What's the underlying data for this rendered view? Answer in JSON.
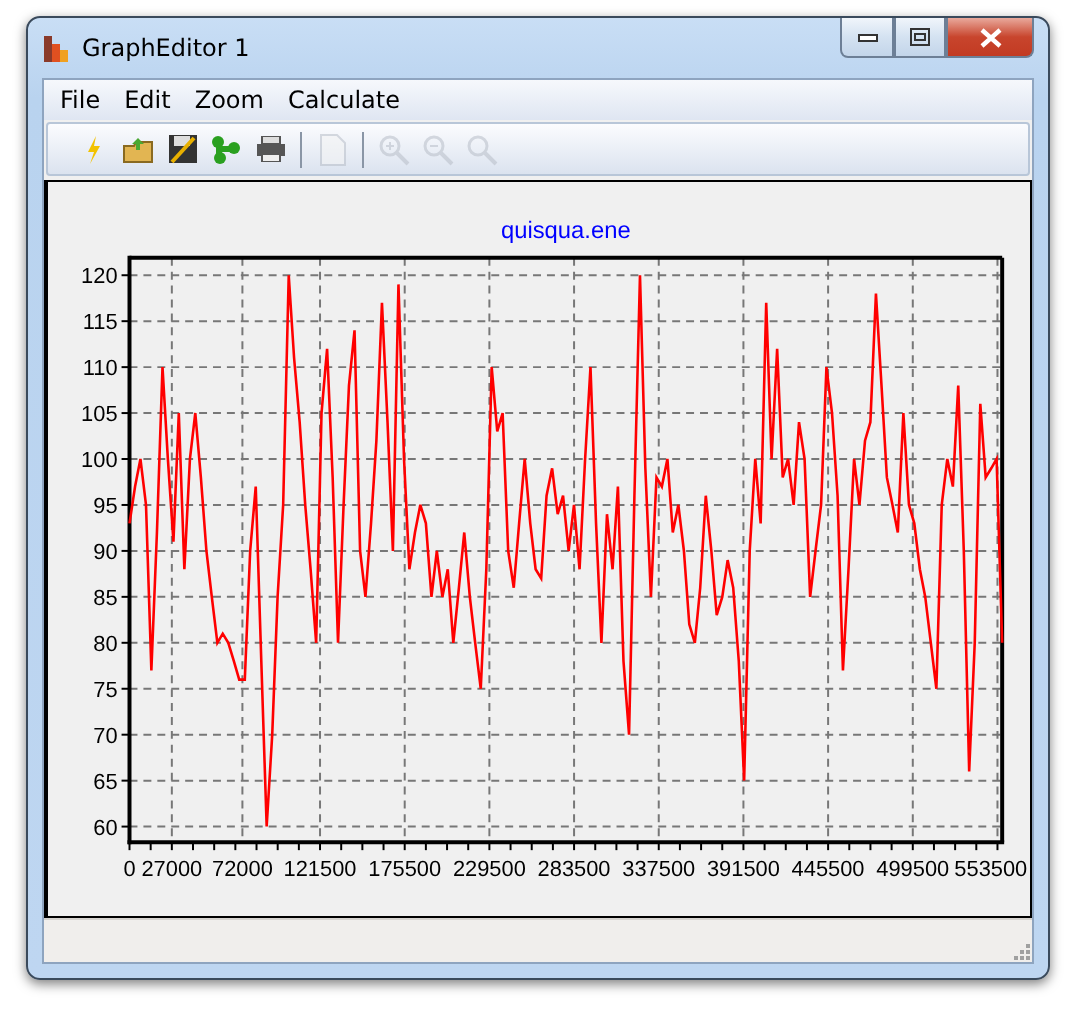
{
  "window": {
    "title": "GraphEditor 1"
  },
  "menu": [
    {
      "label": "File"
    },
    {
      "label": "Edit"
    },
    {
      "label": "Zoom"
    },
    {
      "label": "Calculate"
    }
  ],
  "toolbar": [
    {
      "kind": "lightning",
      "disabled": false
    },
    {
      "kind": "open",
      "disabled": false
    },
    {
      "kind": "save",
      "disabled": false
    },
    {
      "kind": "tree",
      "disabled": false
    },
    {
      "kind": "print",
      "disabled": false
    },
    {
      "kind": "separator"
    },
    {
      "kind": "page",
      "disabled": true
    },
    {
      "kind": "separator"
    },
    {
      "kind": "zoom-in",
      "disabled": true
    },
    {
      "kind": "zoom-out",
      "disabled": true
    },
    {
      "kind": "zoom",
      "disabled": true
    }
  ],
  "graph": {
    "chart_data": {
      "type": "line",
      "title": "quisqua.ene",
      "xlim": [
        0,
        556500
      ],
      "ylim": [
        58.3,
        121.9
      ],
      "grid": true,
      "xticks": [
        0,
        27000,
        72000,
        121500,
        175500,
        229500,
        283500,
        337500,
        391500,
        445500,
        499500,
        553500
      ],
      "yticks": [
        60,
        65,
        70,
        75,
        80,
        85,
        90,
        95,
        100,
        105,
        110,
        115,
        120
      ],
      "x": [
        0,
        3500,
        7000,
        10500,
        14000,
        17500,
        21000,
        24500,
        28000,
        31500,
        35000,
        38500,
        42000,
        45500,
        49000,
        52500,
        56000,
        59500,
        63000,
        66500,
        70000,
        73500,
        77000,
        80500,
        84000,
        87500,
        91000,
        94500,
        98000,
        101500,
        105000,
        108500,
        112000,
        115500,
        119000,
        122500,
        126000,
        129500,
        133000,
        136500,
        140000,
        143500,
        147000,
        150500,
        154000,
        157500,
        161000,
        164500,
        168000,
        171500,
        175000,
        178500,
        182000,
        185500,
        189000,
        192500,
        196000,
        199500,
        203000,
        206500,
        210000,
        213500,
        217000,
        220500,
        224000,
        227500,
        231000,
        234500,
        238000,
        241500,
        245000,
        248500,
        252000,
        255500,
        259000,
        262500,
        266000,
        269500,
        273000,
        276500,
        280000,
        283500,
        287000,
        290500,
        294000,
        297500,
        301000,
        304500,
        308000,
        311500,
        315000,
        318500,
        322000,
        325500,
        329000,
        332500,
        336000,
        339500,
        343000,
        346500,
        350000,
        353500,
        357000,
        360500,
        364000,
        367500,
        371000,
        374500,
        378000,
        381500,
        385000,
        388500,
        392000,
        395500,
        399000,
        402500,
        406000,
        409500,
        413000,
        416500,
        420000,
        423500,
        427000,
        430500,
        434000,
        437500,
        441000,
        444500,
        448000,
        451500,
        455000,
        458500,
        462000,
        465500,
        469000,
        472500,
        476000,
        479500,
        483000,
        486500,
        490000,
        493500,
        497000,
        500500,
        504000,
        507500,
        511000,
        514500,
        518000,
        521500,
        525000,
        528500,
        532000,
        535500,
        539000,
        542500,
        546000,
        549500,
        553000,
        556500
      ],
      "series": [
        {
          "color": "#ff0000",
          "values": [
            93,
            97,
            100,
            95,
            77,
            92,
            110,
            100,
            91,
            105,
            88,
            100,
            105,
            98,
            90,
            85,
            80,
            81,
            80,
            78,
            76,
            76,
            90,
            97,
            78,
            60,
            70,
            85,
            95,
            120,
            111,
            104,
            95,
            88,
            80,
            105,
            112,
            98,
            80,
            95,
            108,
            114,
            90,
            85,
            93,
            102,
            117,
            104,
            90,
            119,
            100,
            88,
            92,
            95,
            93,
            85,
            90,
            85,
            88,
            80,
            86,
            92,
            85,
            80,
            75,
            88,
            110,
            103,
            105,
            90,
            86,
            93,
            100,
            93,
            88,
            87,
            96,
            99,
            94,
            96,
            90,
            95,
            88,
            100,
            110,
            93,
            80,
            94,
            88,
            97,
            78,
            70,
            96,
            120,
            99,
            85,
            98,
            97,
            100,
            92,
            95,
            90,
            82,
            80,
            86,
            96,
            90,
            83,
            85,
            89,
            86,
            78,
            65,
            90,
            100,
            93,
            117,
            100,
            112,
            98,
            100,
            95,
            104,
            100,
            85,
            90,
            95,
            110,
            105,
            96,
            77,
            88,
            100,
            95,
            102,
            104,
            118,
            108,
            98,
            95,
            92,
            105,
            95,
            93,
            88,
            85,
            80,
            75,
            95,
            100,
            97,
            108,
            90,
            66,
            80,
            106,
            98,
            99,
            100,
            80
          ]
        }
      ]
    }
  }
}
